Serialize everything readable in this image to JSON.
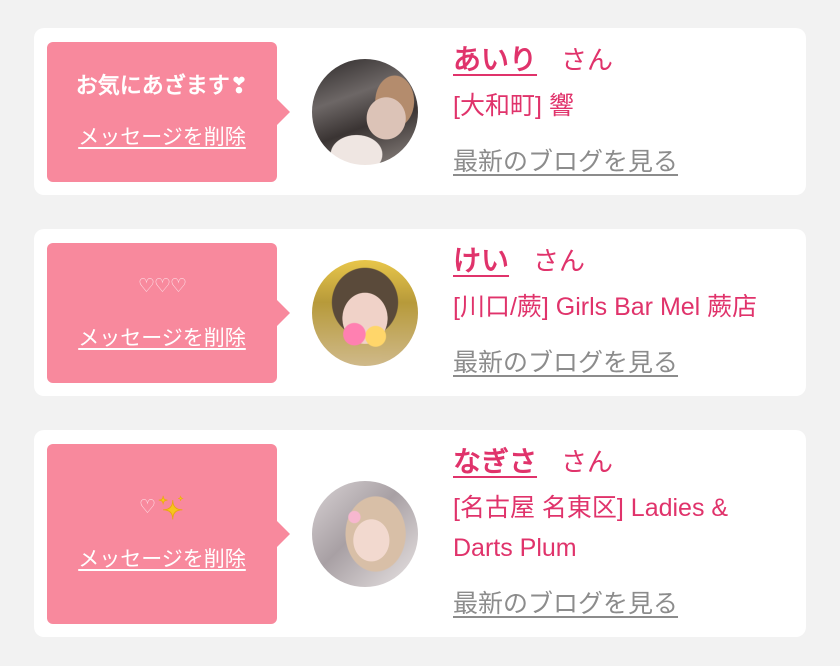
{
  "theme": {
    "background": "#f2f2f2",
    "card": "#ffffff",
    "bubble": "#f8899d",
    "accent": "#e0336b",
    "link_gray": "#8c8c8c"
  },
  "cards": [
    {
      "message": "お気にあざます❣",
      "delete_label": "メッセージを削除",
      "name": "あいり",
      "honorific": "さん",
      "shop": "[大和町] 響",
      "blog_link": "最新のブログを見る"
    },
    {
      "message": "♡♡♡",
      "delete_label": "メッセージを削除",
      "name": "けい",
      "honorific": "さん",
      "shop": "[川口/蕨] Girls Bar Mel 蕨店",
      "blog_link": "最新のブログを見る"
    },
    {
      "message": "♡",
      "message_icon": "sparkles-icon",
      "delete_label": "メッセージを削除",
      "name": "なぎさ",
      "honorific": "さん",
      "shop": "[名古屋 名東区] Ladies & Darts Plum",
      "blog_link": "最新のブログを見る"
    }
  ]
}
